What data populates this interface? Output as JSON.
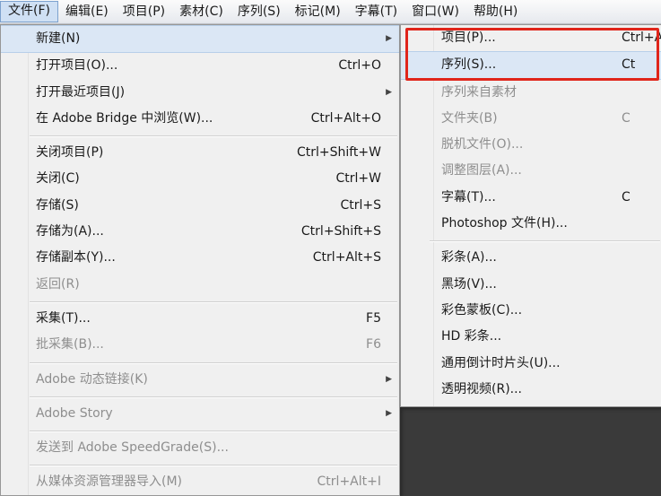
{
  "menubar": {
    "items": [
      "文件(F)",
      "编辑(E)",
      "项目(P)",
      "素材(C)",
      "序列(S)",
      "标记(M)",
      "字幕(T)",
      "窗口(W)",
      "帮助(H)"
    ]
  },
  "file_menu": {
    "items": [
      {
        "label": "新建(N)",
        "shortcut": ""
      },
      {
        "label": "打开项目(O)...",
        "shortcut": "Ctrl+O"
      },
      {
        "label": "打开最近项目(J)",
        "shortcut": ""
      },
      {
        "label": "在 Adobe Bridge 中浏览(W)...",
        "shortcut": "Ctrl+Alt+O"
      },
      {
        "label": "关闭项目(P)",
        "shortcut": "Ctrl+Shift+W"
      },
      {
        "label": "关闭(C)",
        "shortcut": "Ctrl+W"
      },
      {
        "label": "存储(S)",
        "shortcut": "Ctrl+S"
      },
      {
        "label": "存储为(A)...",
        "shortcut": "Ctrl+Shift+S"
      },
      {
        "label": "存储副本(Y)...",
        "shortcut": "Ctrl+Alt+S"
      },
      {
        "label": "返回(R)",
        "shortcut": ""
      },
      {
        "label": "采集(T)...",
        "shortcut": "F5"
      },
      {
        "label": "批采集(B)...",
        "shortcut": "F6"
      },
      {
        "label": "Adobe 动态链接(K)",
        "shortcut": ""
      },
      {
        "label": "Adobe Story",
        "shortcut": ""
      },
      {
        "label": "发送到 Adobe SpeedGrade(S)...",
        "shortcut": ""
      },
      {
        "label": "从媒体资源管理器导入(M)",
        "shortcut": "Ctrl+Alt+I"
      }
    ]
  },
  "new_submenu": {
    "items": [
      {
        "label": "项目(P)...",
        "shortcut": "Ctrl+A"
      },
      {
        "label": "序列(S)...",
        "shortcut": "Ct"
      },
      {
        "label": "序列来自素材",
        "shortcut": ""
      },
      {
        "label": "文件夹(B)",
        "shortcut": "C"
      },
      {
        "label": "脱机文件(O)...",
        "shortcut": ""
      },
      {
        "label": "调整图层(A)...",
        "shortcut": ""
      },
      {
        "label": "字幕(T)...",
        "shortcut": "C"
      },
      {
        "label": "Photoshop 文件(H)...",
        "shortcut": ""
      },
      {
        "label": "彩条(A)...",
        "shortcut": ""
      },
      {
        "label": "黑场(V)...",
        "shortcut": ""
      },
      {
        "label": "彩色蒙板(C)...",
        "shortcut": ""
      },
      {
        "label": "HD 彩条...",
        "shortcut": ""
      },
      {
        "label": "通用倒计时片头(U)...",
        "shortcut": ""
      },
      {
        "label": "透明视频(R)...",
        "shortcut": ""
      }
    ]
  },
  "icons": {
    "submenu_arrow": "triangle-right-icon"
  },
  "colors": {
    "highlight_box": "#e0251b",
    "menu_bg": "#f0f0f0",
    "disabled_text": "#8e8e8e"
  }
}
